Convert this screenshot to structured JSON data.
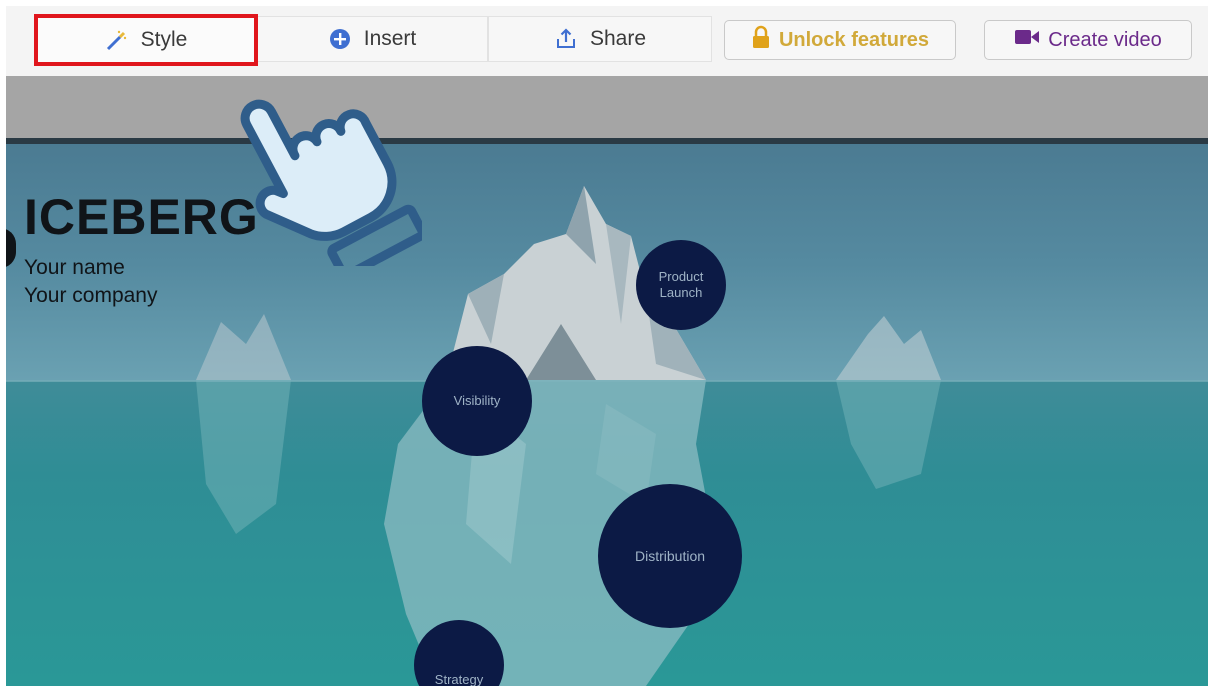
{
  "toolbar": {
    "tabs": [
      {
        "label": "Style",
        "icon": "magic-wand-icon"
      },
      {
        "label": "Insert",
        "icon": "plus-circle-icon"
      },
      {
        "label": "Share",
        "icon": "share-upload-icon"
      }
    ],
    "unlock_label": "Unlock features",
    "create_video_label": "Create video"
  },
  "slide": {
    "title": "ICEBERG",
    "name": "Your name",
    "company": "Your company",
    "nodes": {
      "product": "Product Launch",
      "visibility": "Visibility",
      "distribution": "Distribution",
      "strategy": "Strategy"
    }
  },
  "colors": {
    "highlight": "#e0161c",
    "unlock": "#d1a93a",
    "video": "#6b2a8a",
    "node": "#0c1a45",
    "sky": "#558aa0",
    "water": "#2a9897"
  },
  "overlay": {
    "icon": "tap-hand-icon"
  }
}
